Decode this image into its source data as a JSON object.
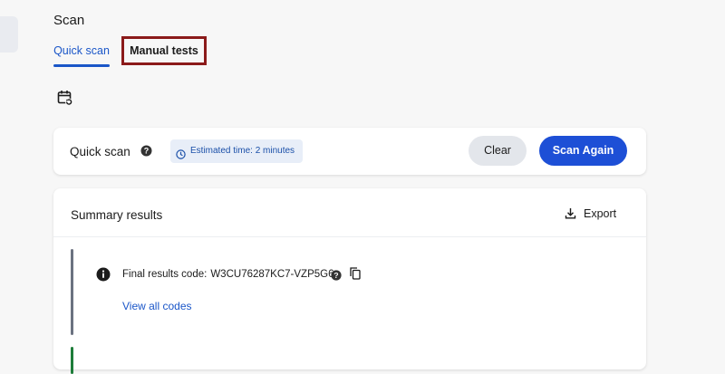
{
  "page": {
    "title": "Scan"
  },
  "tabs": [
    {
      "label": "Quick scan",
      "active": true
    },
    {
      "label": "Manual tests",
      "active": false
    }
  ],
  "icons": {
    "calendar": "calendar-reschedule-icon",
    "help": "question-circle-icon",
    "clock": "clock-icon",
    "export": "download-icon",
    "info": "info-circle-icon",
    "copy": "copy-icon"
  },
  "quick_scan": {
    "label": "Quick scan",
    "estimate": "Estimated time: 2 minutes",
    "clear_label": "Clear",
    "scan_again_label": "Scan Again"
  },
  "summary": {
    "title": "Summary results",
    "export_label": "Export",
    "final_code_label": "Final results code:",
    "final_code_value": "W3CU76287KC7-VZP5G6",
    "view_all_label": "View all codes"
  },
  "colors": {
    "accent": "#1a56c8",
    "primary_button": "#1d4fd6",
    "highlight_border": "#8b1a1a",
    "status_grey": "#6b7280",
    "status_green": "#1e7d3a"
  }
}
